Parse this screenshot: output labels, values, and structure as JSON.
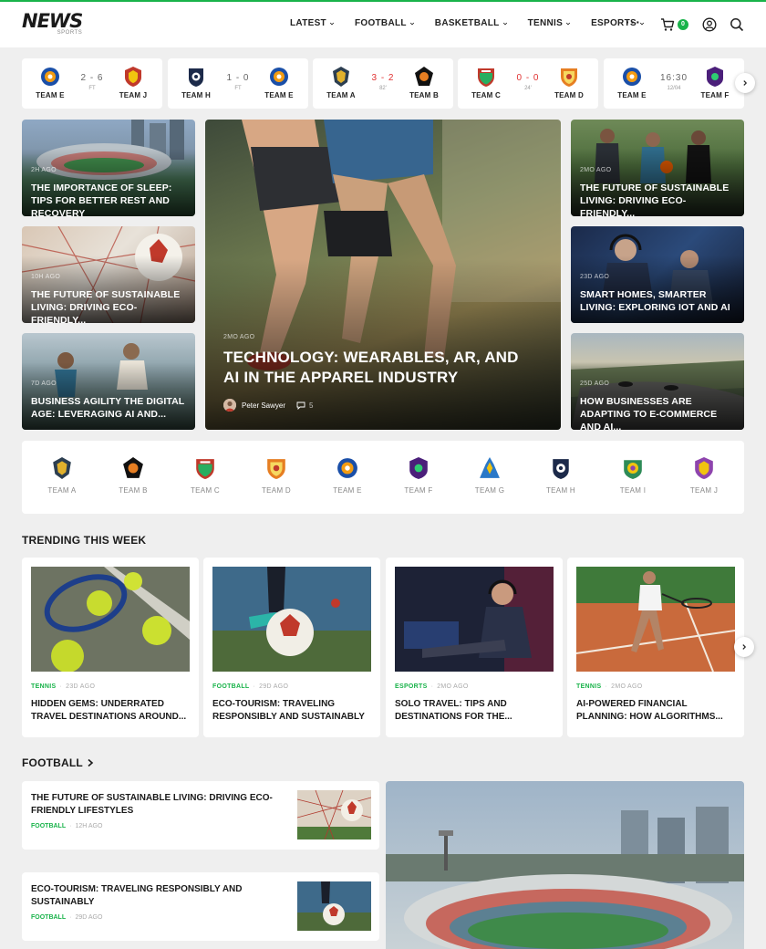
{
  "header": {
    "logo": "NEWS",
    "logo_sub": "SPORTS",
    "nav": [
      "LATEST",
      "FOOTBALL",
      "BASKETBALL",
      "TENNIS",
      "ESPORTS"
    ],
    "more": "···",
    "cart_count": "0"
  },
  "scoreboard": [
    {
      "home": "TEAM E",
      "away": "TEAM J",
      "score": "2 - 6",
      "status": "FT",
      "live": false
    },
    {
      "home": "TEAM H",
      "away": "TEAM E",
      "score": "1 - 0",
      "status": "FT",
      "live": false
    },
    {
      "home": "TEAM A",
      "away": "TEAM B",
      "score": "3 - 2",
      "status": "82'",
      "live": true
    },
    {
      "home": "TEAM C",
      "away": "TEAM D",
      "score": "0 - 0",
      "status": "24'",
      "live": true
    },
    {
      "home": "TEAM E",
      "away": "TEAM F",
      "score": "16:30",
      "status": "12/04",
      "live": false
    }
  ],
  "hero": {
    "left": [
      {
        "time": "2H AGO",
        "title": "THE IMPORTANCE OF SLEEP: TIPS FOR BETTER REST AND RECOVERY"
      },
      {
        "time": "10H AGO",
        "title": "THE FUTURE OF SUSTAINABLE LIVING: DRIVING ECO-FRIENDLY..."
      },
      {
        "time": "7D AGO",
        "title": "BUSINESS AGILITY THE DIGITAL AGE: LEVERAGING AI AND..."
      }
    ],
    "feature": {
      "time": "2MO AGO",
      "title": "TECHNOLOGY: WEARABLES, AR, AND AI IN THE APPAREL INDUSTRY",
      "author": "Peter Sawyer",
      "comments": "5"
    },
    "right": [
      {
        "time": "2MO AGO",
        "title": "THE FUTURE OF SUSTAINABLE LIVING: DRIVING ECO-FRIENDLY..."
      },
      {
        "time": "23D AGO",
        "title": "SMART HOMES, SMARTER LIVING: EXPLORING IOT AND AI"
      },
      {
        "time": "25D AGO",
        "title": "HOW BUSINESSES ARE ADAPTING TO E-COMMERCE AND AI..."
      }
    ]
  },
  "teams": [
    "TEAM A",
    "TEAM B",
    "TEAM C",
    "TEAM D",
    "TEAM E",
    "TEAM F",
    "TEAM G",
    "TEAM H",
    "TEAM I",
    "TEAM J"
  ],
  "trending": {
    "title": "TRENDING THIS WEEK",
    "items": [
      {
        "cat": "TENNIS",
        "time": "23D AGO",
        "title": "HIDDEN GEMS: UNDERRATED TRAVEL DESTINATIONS AROUND..."
      },
      {
        "cat": "FOOTBALL",
        "time": "29D AGO",
        "title": "ECO-TOURISM: TRAVELING RESPONSIBLY AND SUSTAINABLY"
      },
      {
        "cat": "ESPORTS",
        "time": "2MO AGO",
        "title": "SOLO TRAVEL: TIPS AND DESTINATIONS FOR THE..."
      },
      {
        "cat": "TENNIS",
        "time": "2MO AGO",
        "title": "AI-POWERED FINANCIAL PLANNING: HOW ALGORITHMS..."
      }
    ]
  },
  "football": {
    "title": "FOOTBALL",
    "items": [
      {
        "cat": "FOOTBALL",
        "time": "12H AGO",
        "title": "THE FUTURE OF SUSTAINABLE LIVING: DRIVING ECO-FRIENDLY LIFESTYLES"
      },
      {
        "cat": "FOOTBALL",
        "time": "29D AGO",
        "title": "ECO-TOURISM: TRAVELING RESPONSIBLY AND SUSTAINABLY"
      }
    ]
  },
  "colors": {
    "accent": "#19b34a",
    "live": "#e03131",
    "background": "#efefef"
  }
}
